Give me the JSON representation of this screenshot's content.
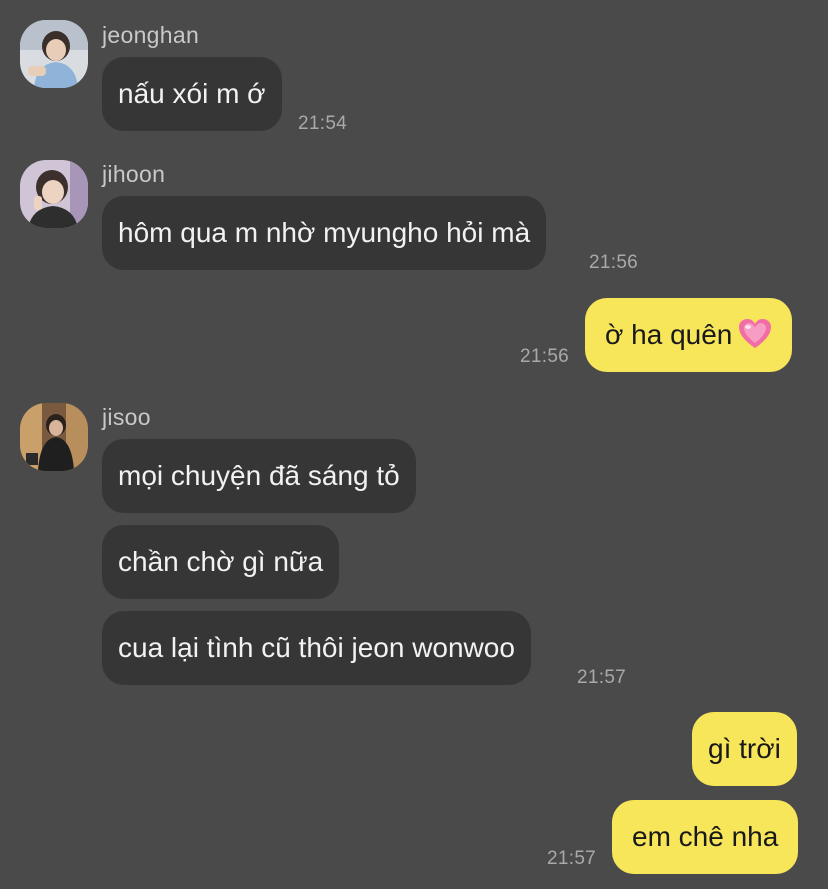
{
  "conversation": {
    "groups": [
      {
        "sender": "jeonghan",
        "messages": [
          "nấu xói m ớ"
        ],
        "time": "21:54"
      },
      {
        "sender": "jihoon",
        "messages": [
          "hôm qua m nhờ myungho hỏi mà"
        ],
        "time": "21:56"
      },
      {
        "sender": "me",
        "messages": [
          "ờ ha quên"
        ],
        "emoji": "pink-heart",
        "time": "21:56"
      },
      {
        "sender": "jisoo",
        "messages": [
          "mọi chuyện đã sáng tỏ",
          "chần chờ gì nữa",
          "cua lại tình cũ thôi jeon wonwoo"
        ],
        "time": "21:57"
      },
      {
        "sender": "me",
        "messages": [
          "gì trời",
          "em chê nha"
        ],
        "time": "21:57"
      }
    ]
  },
  "colors": {
    "background": "#4a4a4a",
    "incoming_bubble": "#363636",
    "outgoing_bubble": "#f7e55a",
    "incoming_text": "#f2f2f2",
    "outgoing_text": "#191919",
    "timestamp": "#a9a9a9",
    "sender_name": "#c9c9c9"
  }
}
